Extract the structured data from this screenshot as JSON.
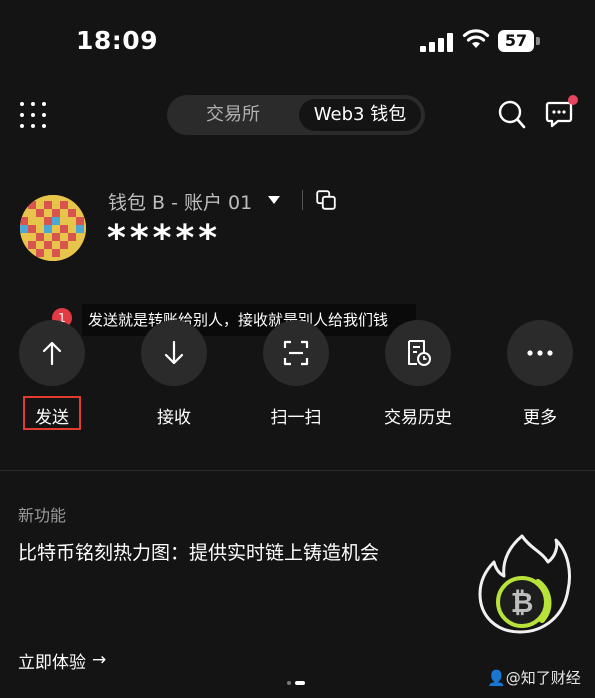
{
  "status_bar": {
    "time": "18:09",
    "battery": "57"
  },
  "header": {
    "tabs": [
      {
        "label": "交易所"
      },
      {
        "label": "Web3 钱包"
      }
    ]
  },
  "account": {
    "name": "钱包 B - 账户 01",
    "balance": "*****"
  },
  "tooltip": {
    "badge": "1",
    "text": "发送就是转账给别人，接收就是别人给我们钱"
  },
  "actions": [
    {
      "label": "发送",
      "icon": "arrow-up-icon"
    },
    {
      "label": "接收",
      "icon": "arrow-down-icon"
    },
    {
      "label": "扫一扫",
      "icon": "scan-icon"
    },
    {
      "label": "交易历史",
      "icon": "history-icon"
    },
    {
      "label": "更多",
      "icon": "more-icon"
    }
  ],
  "feature": {
    "tag": "新功能",
    "title": "比特币铭刻热力图：提供实时链上铸造机会",
    "cta": "立即体验",
    "cta_arrow": "→"
  },
  "watermark": "知了财经",
  "colors": {
    "background": "#141414",
    "highlight_box": "#e23b30",
    "badge": "#e23b44",
    "notification_dot": "#e5455f"
  }
}
